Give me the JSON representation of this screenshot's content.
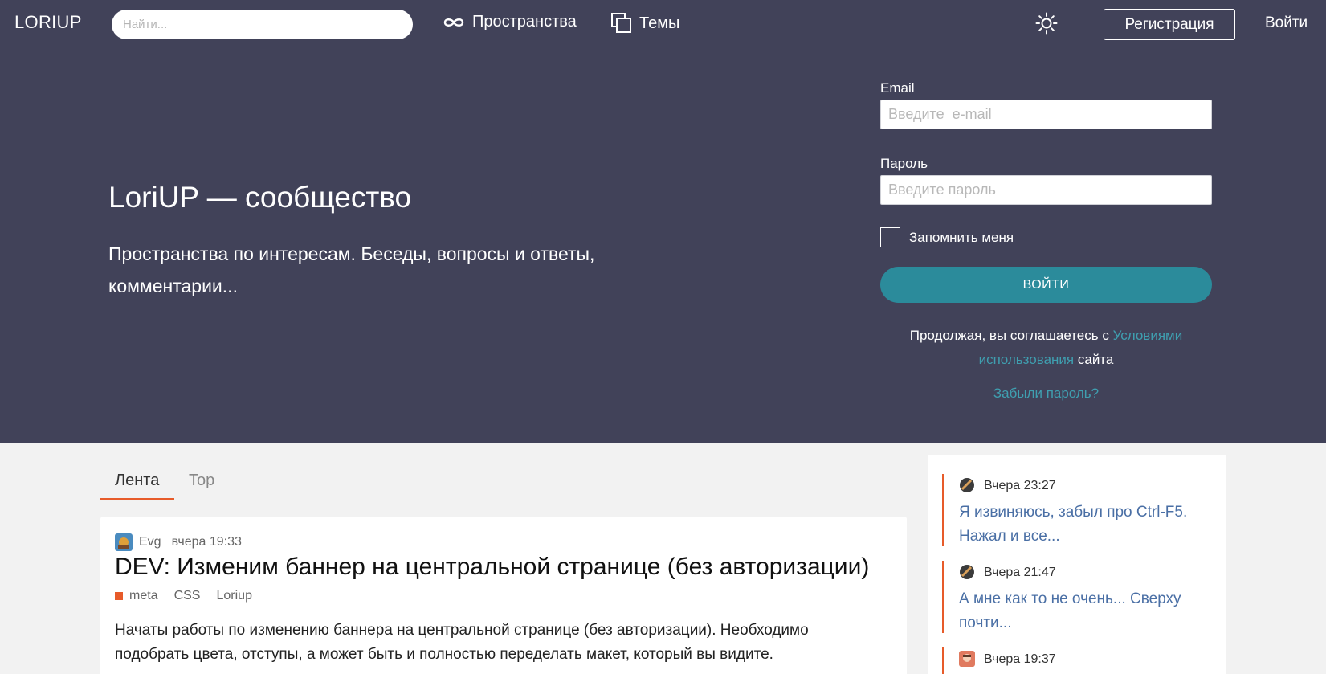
{
  "header": {
    "logo": "LORIUP",
    "search_placeholder": "Найти...",
    "nav": [
      {
        "label": "Пространства",
        "icon": "infinity-icon"
      },
      {
        "label": "Темы",
        "icon": "topics-icon"
      }
    ],
    "theme_icon": "sun-icon",
    "register_label": "Регистрация",
    "login_label": "Войти"
  },
  "hero": {
    "title": "LoriUP — сообщество",
    "subtitle": "Пространства по интересам. Беседы, вопросы и ответы, комментарии..."
  },
  "login_form": {
    "email_label": "Email",
    "email_placeholder": "Введите  e-mail",
    "password_label": "Пароль",
    "password_placeholder": "Введите пароль",
    "remember_label": "Запомнить меня",
    "submit_label": "ВОЙТИ",
    "terms_prefix": "Продолжая, вы соглашаетесь с",
    "terms_link": "Условиями использования",
    "terms_suffix": "сайта",
    "forgot_label": "Забыли пароль?"
  },
  "feed": {
    "tabs": [
      {
        "label": "Лента",
        "active": true
      },
      {
        "label": "Top",
        "active": false
      }
    ],
    "posts": [
      {
        "author": "Evg",
        "date": "вчера 19:33",
        "title": "DEV: Изменим баннер на центральной странице (без авторизации)",
        "tags": [
          "meta",
          "CSS",
          "Loriup"
        ],
        "body": "Начаты работы по изменению баннера на центральной странице (без авторизации). Необходимо подобрать цвета, отступы, а может быть и полностью переделать макет, который вы видите."
      }
    ]
  },
  "sidebar": {
    "comments": [
      {
        "time": "Вчера 23:27",
        "text": "Я извиняюсь, забыл про Ctrl-F5. Нажал и все..."
      },
      {
        "time": "Вчера 21:47",
        "text": "А мне как то не очень... Сверху почти..."
      },
      {
        "time": "Вчера 19:37",
        "text": ""
      }
    ]
  },
  "colors": {
    "header_bg": "#414259",
    "accent": "#2b8b9b",
    "tag_accent": "#e75b2a",
    "link": "#3f9fb0",
    "comment_link": "#4a6fa5"
  }
}
